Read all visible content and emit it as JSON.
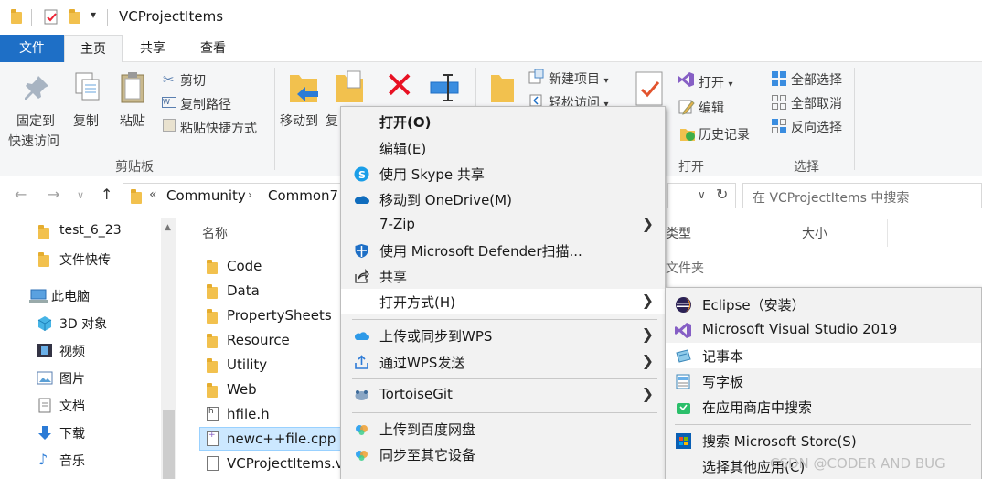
{
  "window": {
    "title": "VCProjectItems"
  },
  "tabs": {
    "file": "文件",
    "home": "主页",
    "share": "共享",
    "view": "查看"
  },
  "ribbon": {
    "pin_quick_access": [
      "固定到",
      "快速访问"
    ],
    "copy": "复制",
    "paste": "粘贴",
    "cut": "剪切",
    "copy_path": "复制路径",
    "paste_shortcut": "粘贴快捷方式",
    "clipboard_group": "剪贴板",
    "move_to": "移动到",
    "copy_to_partial": "复",
    "new_item": "新建项目",
    "easy_access": "轻松访问",
    "open": "打开",
    "edit": "编辑",
    "history": "历史记录",
    "open_group": "打开",
    "select_all": "全部选择",
    "select_none": "全部取消",
    "invert_selection": "反向选择",
    "select_group": "选择"
  },
  "address": {
    "prefix": "«",
    "crumb1": "Community",
    "crumb2": "Common7",
    "search_placeholder": "在 VCProjectItems 中搜索"
  },
  "nav": {
    "items": [
      {
        "label": "test_6_23"
      },
      {
        "label": "文件快传"
      },
      {
        "label": "此电脑"
      },
      {
        "label": "3D 对象"
      },
      {
        "label": "视频"
      },
      {
        "label": "图片"
      },
      {
        "label": "文档"
      },
      {
        "label": "下载"
      },
      {
        "label": "音乐"
      }
    ]
  },
  "columns": {
    "name": "名称",
    "type": "类型",
    "size": "大小"
  },
  "files": [
    {
      "name": "Code",
      "kind": "folder"
    },
    {
      "name": "Data",
      "kind": "folder"
    },
    {
      "name": "PropertySheets",
      "kind": "folder"
    },
    {
      "name": "Resource",
      "kind": "folder"
    },
    {
      "name": "Utility",
      "kind": "folder"
    },
    {
      "name": "Web",
      "kind": "folder"
    },
    {
      "name": "hfile.h",
      "kind": "file"
    },
    {
      "name": "newc++file.cpp",
      "kind": "file",
      "selected": true
    },
    {
      "name": "VCProjectItems.v",
      "kind": "file"
    }
  ],
  "type_value": "文件夹",
  "context_menu": {
    "items": [
      "打开(O)",
      "编辑(E)",
      "使用 Skype 共享",
      "移动到 OneDrive(M)",
      "7-Zip",
      "使用 Microsoft Defender扫描...",
      "共享",
      "打开方式(H)",
      "上传或同步到WPS",
      "通过WPS发送",
      "TortoiseGit",
      "上传到百度网盘",
      "同步至其它设备"
    ]
  },
  "submenu": {
    "items": [
      "Eclipse（安装）",
      "Microsoft Visual Studio 2019",
      "记事本",
      "写字板",
      "在应用商店中搜索",
      "搜索 Microsoft Store(S)",
      "选择其他应用(C)"
    ]
  },
  "watermark": "CSDN @CODER AND BUG",
  "colors": {
    "accent": "#1e6fc6",
    "selection": "#cce8ff",
    "folder": "#f2c14e",
    "vs_purple": "#865fc5",
    "delete_red": "#e81123"
  }
}
